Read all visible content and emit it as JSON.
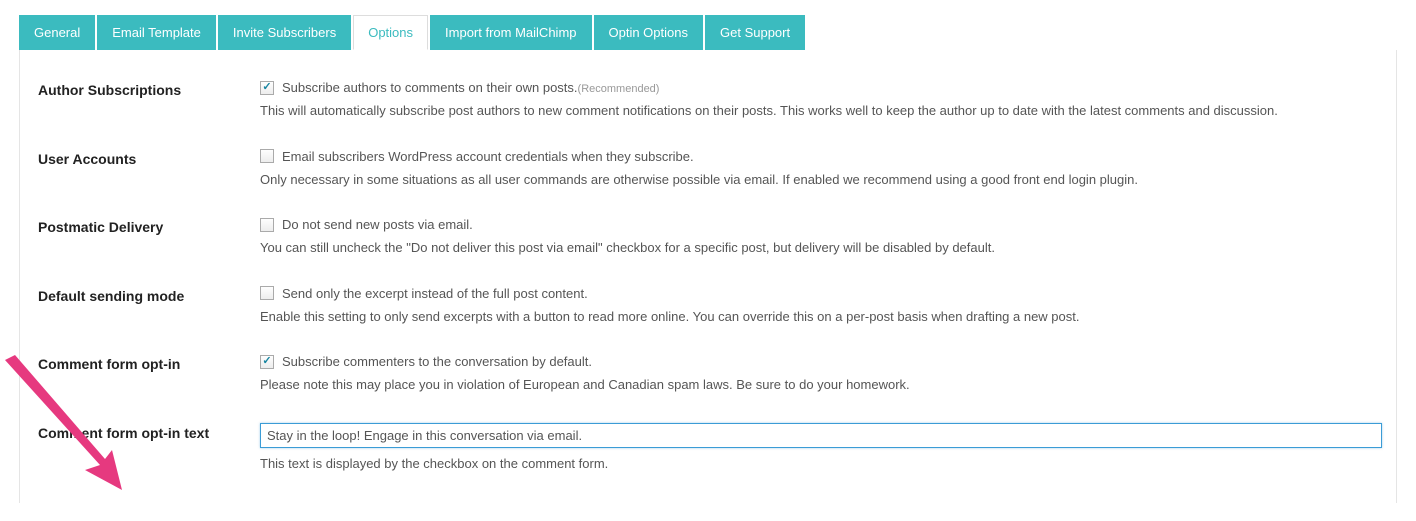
{
  "tabs": {
    "general": "General",
    "email_template": "Email Template",
    "invite_subscribers": "Invite Subscribers",
    "options": "Options",
    "import_mailchimp": "Import from MailChimp",
    "optin_options": "Optin Options",
    "get_support": "Get Support"
  },
  "rows": {
    "author_subscriptions": {
      "label": "Author Subscriptions",
      "check_label": "Subscribe authors to comments on their own posts.",
      "recommended": "(Recommended)",
      "desc": "This will automatically subscribe post authors to new comment notifications on their posts. This works well to keep the author up to date with the latest comments and discussion."
    },
    "user_accounts": {
      "label": "User Accounts",
      "check_label": "Email subscribers WordPress account credentials when they subscribe.",
      "desc": "Only necessary in some situations as all user commands are otherwise possible via email. If enabled we recommend using a good front end login plugin."
    },
    "postmatic_delivery": {
      "label": "Postmatic Delivery",
      "check_label": "Do not send new posts via email.",
      "desc": "You can still uncheck the \"Do not deliver this post via email\" checkbox for a specific post, but delivery will be disabled by default."
    },
    "default_sending_mode": {
      "label": "Default sending mode",
      "check_label": "Send only the excerpt instead of the full post content.",
      "desc": "Enable this setting to only send excerpts with a button to read more online. You can override this on a per-post basis when drafting a new post."
    },
    "comment_form_optin": {
      "label": "Comment form opt-in",
      "check_label": "Subscribe commenters to the conversation by default.",
      "desc": "Please note this may place you in violation of European and Canadian spam laws. Be sure to do your homework."
    },
    "comment_form_optin_text": {
      "label": "Comment form opt-in text",
      "value": "Stay in the loop! Engage in this conversation via email.",
      "desc": "This text is displayed by the checkbox on the comment form."
    }
  }
}
